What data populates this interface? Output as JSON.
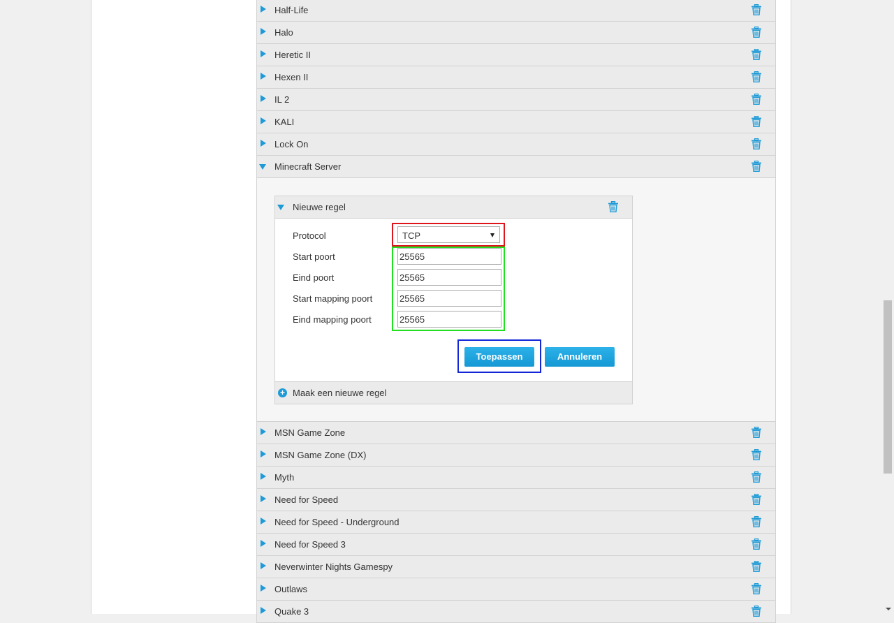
{
  "games_above": [
    "Half-Life",
    "Halo",
    "Heretic II",
    "Hexen II",
    "IL 2",
    "KALI",
    "Lock On"
  ],
  "expanded_game": {
    "name": "Minecraft Server",
    "rule": {
      "title": "Nieuwe regel",
      "fields": {
        "protocol_label": "Protocol",
        "protocol_value": "TCP",
        "start_port_label": "Start poort",
        "start_port_value": "25565",
        "end_port_label": "Eind poort",
        "end_port_value": "25565",
        "start_mapping_label": "Start mapping poort",
        "start_mapping_value": "25565",
        "end_mapping_label": "Eind mapping poort",
        "end_mapping_value": "25565"
      },
      "apply_label": "Toepassen",
      "cancel_label": "Annuleren"
    },
    "add_rule_label": "Maak een nieuwe regel"
  },
  "games_below": [
    "MSN Game Zone",
    "MSN Game Zone (DX)",
    "Myth",
    "Need for Speed",
    "Need for Speed - Underground",
    "Need for Speed 3",
    "Neverwinter Nights Gamespy",
    "Outlaws",
    "Quake 3"
  ],
  "colors": {
    "accent": "#1e9bd7",
    "highlight_protocol": "#e0141b",
    "highlight_ports": "#20e020",
    "highlight_apply": "#1427d8"
  }
}
